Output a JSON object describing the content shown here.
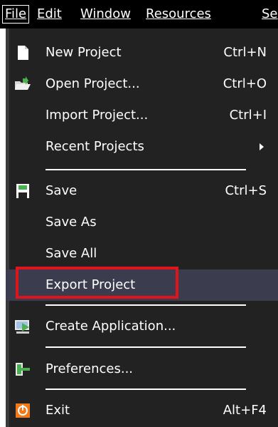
{
  "menubar": {
    "items": [
      {
        "label": "File",
        "active": true
      },
      {
        "label": "Edit"
      },
      {
        "label": "Window"
      },
      {
        "label": "Resources"
      },
      {
        "label": "Se"
      }
    ]
  },
  "menu": {
    "new_project": {
      "label": "New Project",
      "shortcut": "Ctrl+N",
      "icon": "new-document-icon"
    },
    "open_project": {
      "label": "Open Project...",
      "shortcut": "Ctrl+O",
      "icon": "open-folder-icon"
    },
    "import_project": {
      "label": "Import Project...",
      "shortcut": "Ctrl+I"
    },
    "recent_projects": {
      "label": "Recent Projects",
      "submenu": true
    },
    "save": {
      "label": "Save",
      "shortcut": "Ctrl+S",
      "icon": "save-disk-icon"
    },
    "save_as": {
      "label": "Save As"
    },
    "save_all": {
      "label": "Save All"
    },
    "export_project": {
      "label": "Export Project",
      "highlighted": true
    },
    "create_application": {
      "label": "Create Application...",
      "icon": "create-application-icon"
    },
    "preferences": {
      "label": "Preferences...",
      "icon": "preferences-icon"
    },
    "exit": {
      "label": "Exit",
      "shortcut": "Alt+F4",
      "icon": "exit-icon"
    }
  },
  "colors": {
    "menu_bg": "#222222",
    "highlight_bg": "#3b3c4e",
    "callout_border": "#e0151c"
  }
}
